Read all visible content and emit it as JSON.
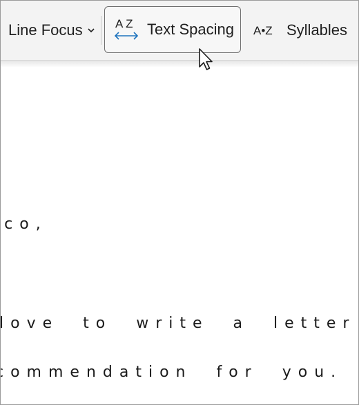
{
  "toolbar": {
    "line_focus_label": "Line Focus",
    "text_spacing_label": "Text Spacing",
    "text_spacing_icon_letters": "A Z",
    "syllables_label": "Syllables",
    "syllables_icon_text": "A•Z"
  },
  "document": {
    "lines": [
      "rico,",
      " love to write a letter o",
      "commendation for you. Do"
    ]
  },
  "icons": {
    "chevron": "chevron-down-icon",
    "text_spacing": "text-spacing-icon",
    "syllables": "syllables-icon",
    "cursor": "mouse-pointer-icon"
  },
  "colors": {
    "toolbar_bg": "#f3f3f3",
    "text": "#1f1f1f",
    "accent_arrow": "#1e73be",
    "active_button_border": "#6f6f6f",
    "document_bg": "#ffffff"
  }
}
